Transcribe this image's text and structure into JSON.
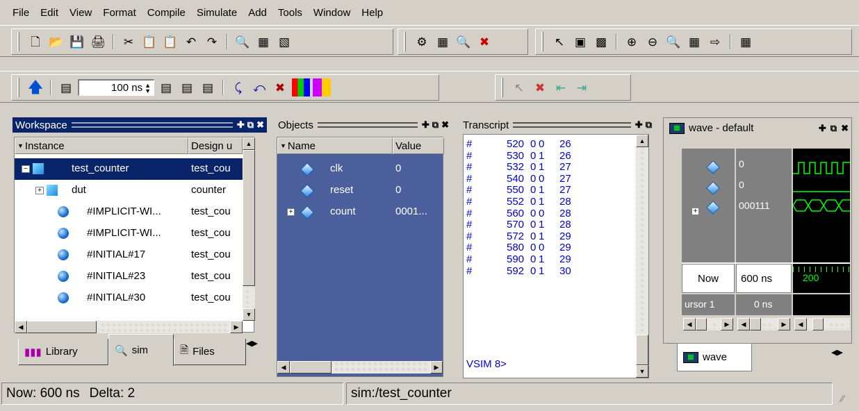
{
  "menu": [
    "File",
    "Edit",
    "View",
    "Format",
    "Compile",
    "Simulate",
    "Add",
    "Tools",
    "Window",
    "Help"
  ],
  "toolbar": {
    "run_length": "100 ns"
  },
  "workspace": {
    "title": "Workspace",
    "col_instance": "Instance",
    "col_design": "Design u",
    "rows": [
      {
        "name": "test_counter",
        "design": "test_cou"
      },
      {
        "name": "dut",
        "design": "counter"
      },
      {
        "name": "#IMPLICIT-WI...",
        "design": "test_cou"
      },
      {
        "name": "#IMPLICIT-WI...",
        "design": "test_cou"
      },
      {
        "name": "#INITIAL#17",
        "design": "test_cou"
      },
      {
        "name": "#INITIAL#23",
        "design": "test_cou"
      },
      {
        "name": "#INITIAL#30",
        "design": "test_cou"
      }
    ],
    "tabs": [
      "Library",
      "sim",
      "Files"
    ]
  },
  "objects": {
    "title": "Objects",
    "col_name": "Name",
    "col_value": "Value",
    "rows": [
      {
        "name": "clk",
        "value": "0"
      },
      {
        "name": "reset",
        "value": "0"
      },
      {
        "name": "count",
        "value": "0001..."
      }
    ]
  },
  "transcript": {
    "title": "Transcript",
    "lines": [
      {
        "hash": "#",
        "time": "520",
        "a": "0",
        "b": "0",
        "n": "26"
      },
      {
        "hash": "#",
        "time": "530",
        "a": "0",
        "b": "1",
        "n": "26"
      },
      {
        "hash": "#",
        "time": "532",
        "a": "0",
        "b": "1",
        "n": "27"
      },
      {
        "hash": "#",
        "time": "540",
        "a": "0",
        "b": "0",
        "n": "27"
      },
      {
        "hash": "#",
        "time": "550",
        "a": "0",
        "b": "1",
        "n": "27"
      },
      {
        "hash": "#",
        "time": "552",
        "a": "0",
        "b": "1",
        "n": "28"
      },
      {
        "hash": "#",
        "time": "560",
        "a": "0",
        "b": "0",
        "n": "28"
      },
      {
        "hash": "#",
        "time": "570",
        "a": "0",
        "b": "1",
        "n": "28"
      },
      {
        "hash": "#",
        "time": "572",
        "a": "0",
        "b": "1",
        "n": "29"
      },
      {
        "hash": "#",
        "time": "580",
        "a": "0",
        "b": "0",
        "n": "29"
      },
      {
        "hash": "#",
        "time": "590",
        "a": "0",
        "b": "1",
        "n": "29"
      },
      {
        "hash": "#",
        "time": "592",
        "a": "0",
        "b": "1",
        "n": "30"
      }
    ],
    "prompt": "VSIM 8>"
  },
  "wave": {
    "title": "wave - default",
    "values": [
      "0",
      "0",
      "000111"
    ],
    "now_label": "Now",
    "now_value": "600 ns",
    "cursor_label": "ursor 1",
    "cursor_value": "0 ns",
    "ruler_value": "200",
    "tab": "wave"
  },
  "status": {
    "now": "Now: 600 ns",
    "delta": "Delta: 2",
    "context": "sim:/test_counter"
  },
  "colors": {
    "title_active": "#0a246a",
    "objects_bg": "#4a5f9b",
    "transcript_text": "#0000cc",
    "wave_green": "#00ff00"
  }
}
